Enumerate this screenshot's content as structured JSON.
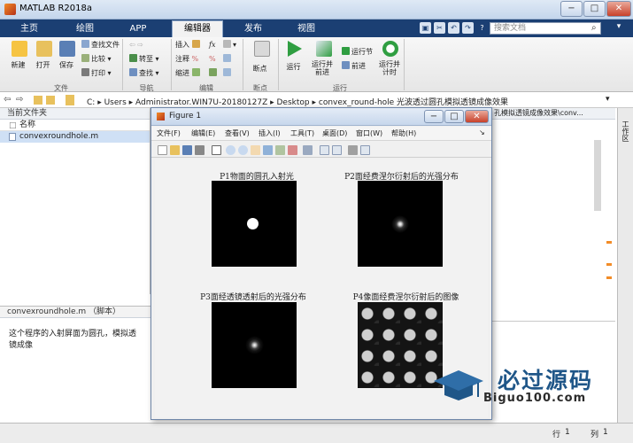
{
  "window": {
    "title": "MATLAB R2018a",
    "min": "−",
    "max": "□",
    "close": "✕"
  },
  "tabs": [
    {
      "label": "主页"
    },
    {
      "label": "绘图"
    },
    {
      "label": "APP"
    },
    {
      "label": "编辑器"
    },
    {
      "label": "发布"
    },
    {
      "label": "视图"
    }
  ],
  "search": {
    "placeholder": "搜索文档"
  },
  "ribbon": {
    "file": {
      "new": "新建",
      "open": "打开",
      "save": "保存",
      "find_files": "查找文件",
      "compare": "比较",
      "print": "打印",
      "group": "文件"
    },
    "navigate": {
      "goto": "转至",
      "find": "查找",
      "group": "导航"
    },
    "edit": {
      "insert": "插入",
      "comment": "注释",
      "indent": "缩进",
      "fx": "fx",
      "percent": "%",
      "group": "编辑"
    },
    "breakpoints": {
      "label": "断点",
      "group": "断点"
    },
    "run": {
      "run": "运行",
      "run_advance": "运行并\n前进",
      "run_section": "运行节",
      "advance": "前进",
      "run_time": "运行并\n计时",
      "group": "运行"
    }
  },
  "address": {
    "segments": [
      "C:",
      "Users",
      "Administrator.WIN7U-20180127Z",
      "Desktop",
      "convex_round-hole 光波透过圆孔模拟透镜成像效果"
    ]
  },
  "current_folder": {
    "header": "当前文件夹",
    "column_name": "名称",
    "files": [
      {
        "name": "convexroundhole.m"
      }
    ]
  },
  "details": {
    "header": "convexroundhole.m （脚本）",
    "description": "这个程序的入射屏面为圆孔，模拟透镜成像"
  },
  "right_panel": {
    "header": "孔模拟透镜成像效果\\conv..."
  },
  "workspace_tab": "工作区",
  "status": {
    "row_label": "行",
    "row": "1",
    "col_label": "列",
    "col": "1"
  },
  "figure": {
    "title": "Figure 1",
    "menu": [
      "文件(F)",
      "编辑(E)",
      "查看(V)",
      "插入(I)",
      "工具(T)",
      "桌面(D)",
      "窗口(W)",
      "帮助(H)"
    ],
    "subplots": [
      {
        "title": "P1物面的圆孔入射光"
      },
      {
        "title": "P2面经费涅尔衍射后的光强分布"
      },
      {
        "title": "P3面经透镜透射后的光强分布"
      },
      {
        "title": "P4像面经费涅尔衍射后的图像"
      }
    ]
  },
  "watermark": {
    "text": "必过源码",
    "url": "Biguo100.com"
  },
  "colors": {
    "tab_strip": "#1b3f73",
    "accent": "#f28c28",
    "figure_bg": "#f2f2f2"
  }
}
